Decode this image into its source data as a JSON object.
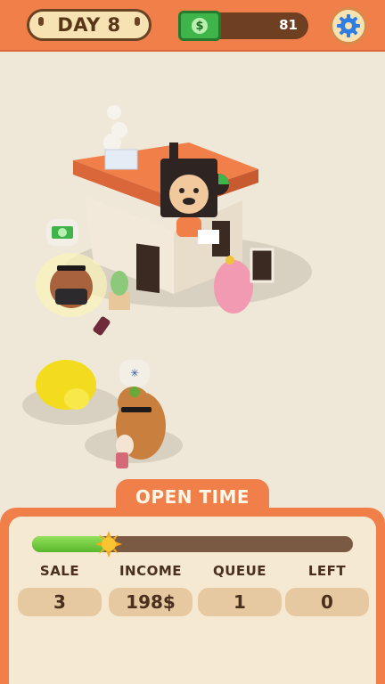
{
  "header": {
    "day_label": "DAY 8",
    "money_value": "81",
    "money_icon": "cash-icon",
    "settings_icon": "gear-icon"
  },
  "scene": {
    "price_bubble_icon": "cash-icon",
    "speech_bubble_icon": "dizzy-icon"
  },
  "panel": {
    "title": "OPEN TIME",
    "progress": 0.24,
    "progress_marker_icon": "sun-icon",
    "stats": [
      {
        "label": "SALE",
        "value": "3"
      },
      {
        "label": "INCOME",
        "value": "198$"
      },
      {
        "label": "QUEUE",
        "value": "1"
      },
      {
        "label": "LEFT",
        "value": "0"
      }
    ]
  },
  "colors": {
    "accent_orange": "#f07f4a",
    "panel_cream": "#f6e9d2",
    "progress_green": "#58b62c",
    "money_green": "#3fb44b"
  }
}
